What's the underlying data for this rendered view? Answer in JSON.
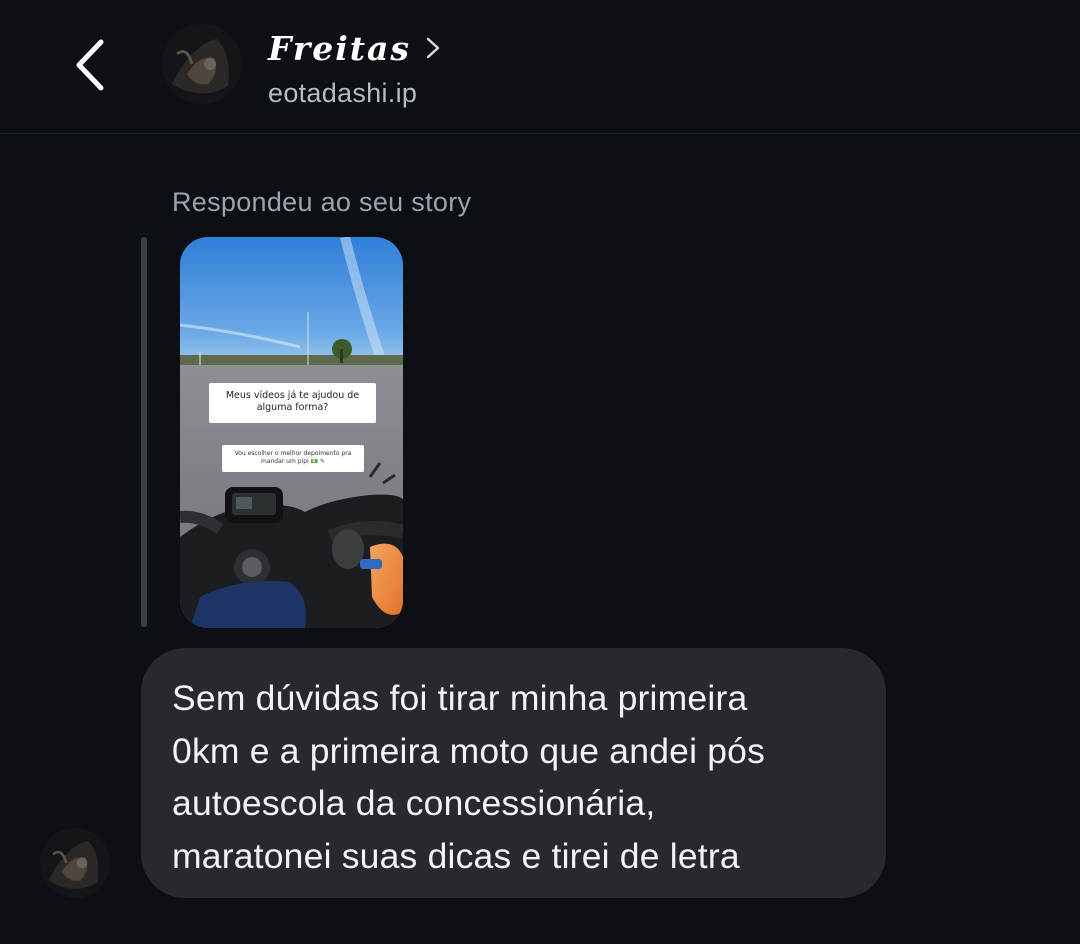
{
  "header": {
    "back_icon": "chevron-left-icon",
    "contact_name": "Freitas",
    "contact_handle": "eotadashi.ip",
    "name_chevron_icon": "chevron-right-icon"
  },
  "story_reply": {
    "label": "Respondeu ao seu story",
    "story_text_1": "Meus vídeos já te ajudou de alguma forma?",
    "story_text_2": "Vou escolher o melhor depoimento pra mandar um pipi 💵 ✎"
  },
  "message": {
    "text": "Sem dúvidas foi tirar minha primeira\n0km e a primeira moto que andei pós\nautoescola da concessionária,\nmaratonei suas dicas e tirei de letra"
  },
  "colors": {
    "background": "#0c0f14",
    "bubble": "#26292e",
    "secondary_text": "#9ea3ab"
  }
}
